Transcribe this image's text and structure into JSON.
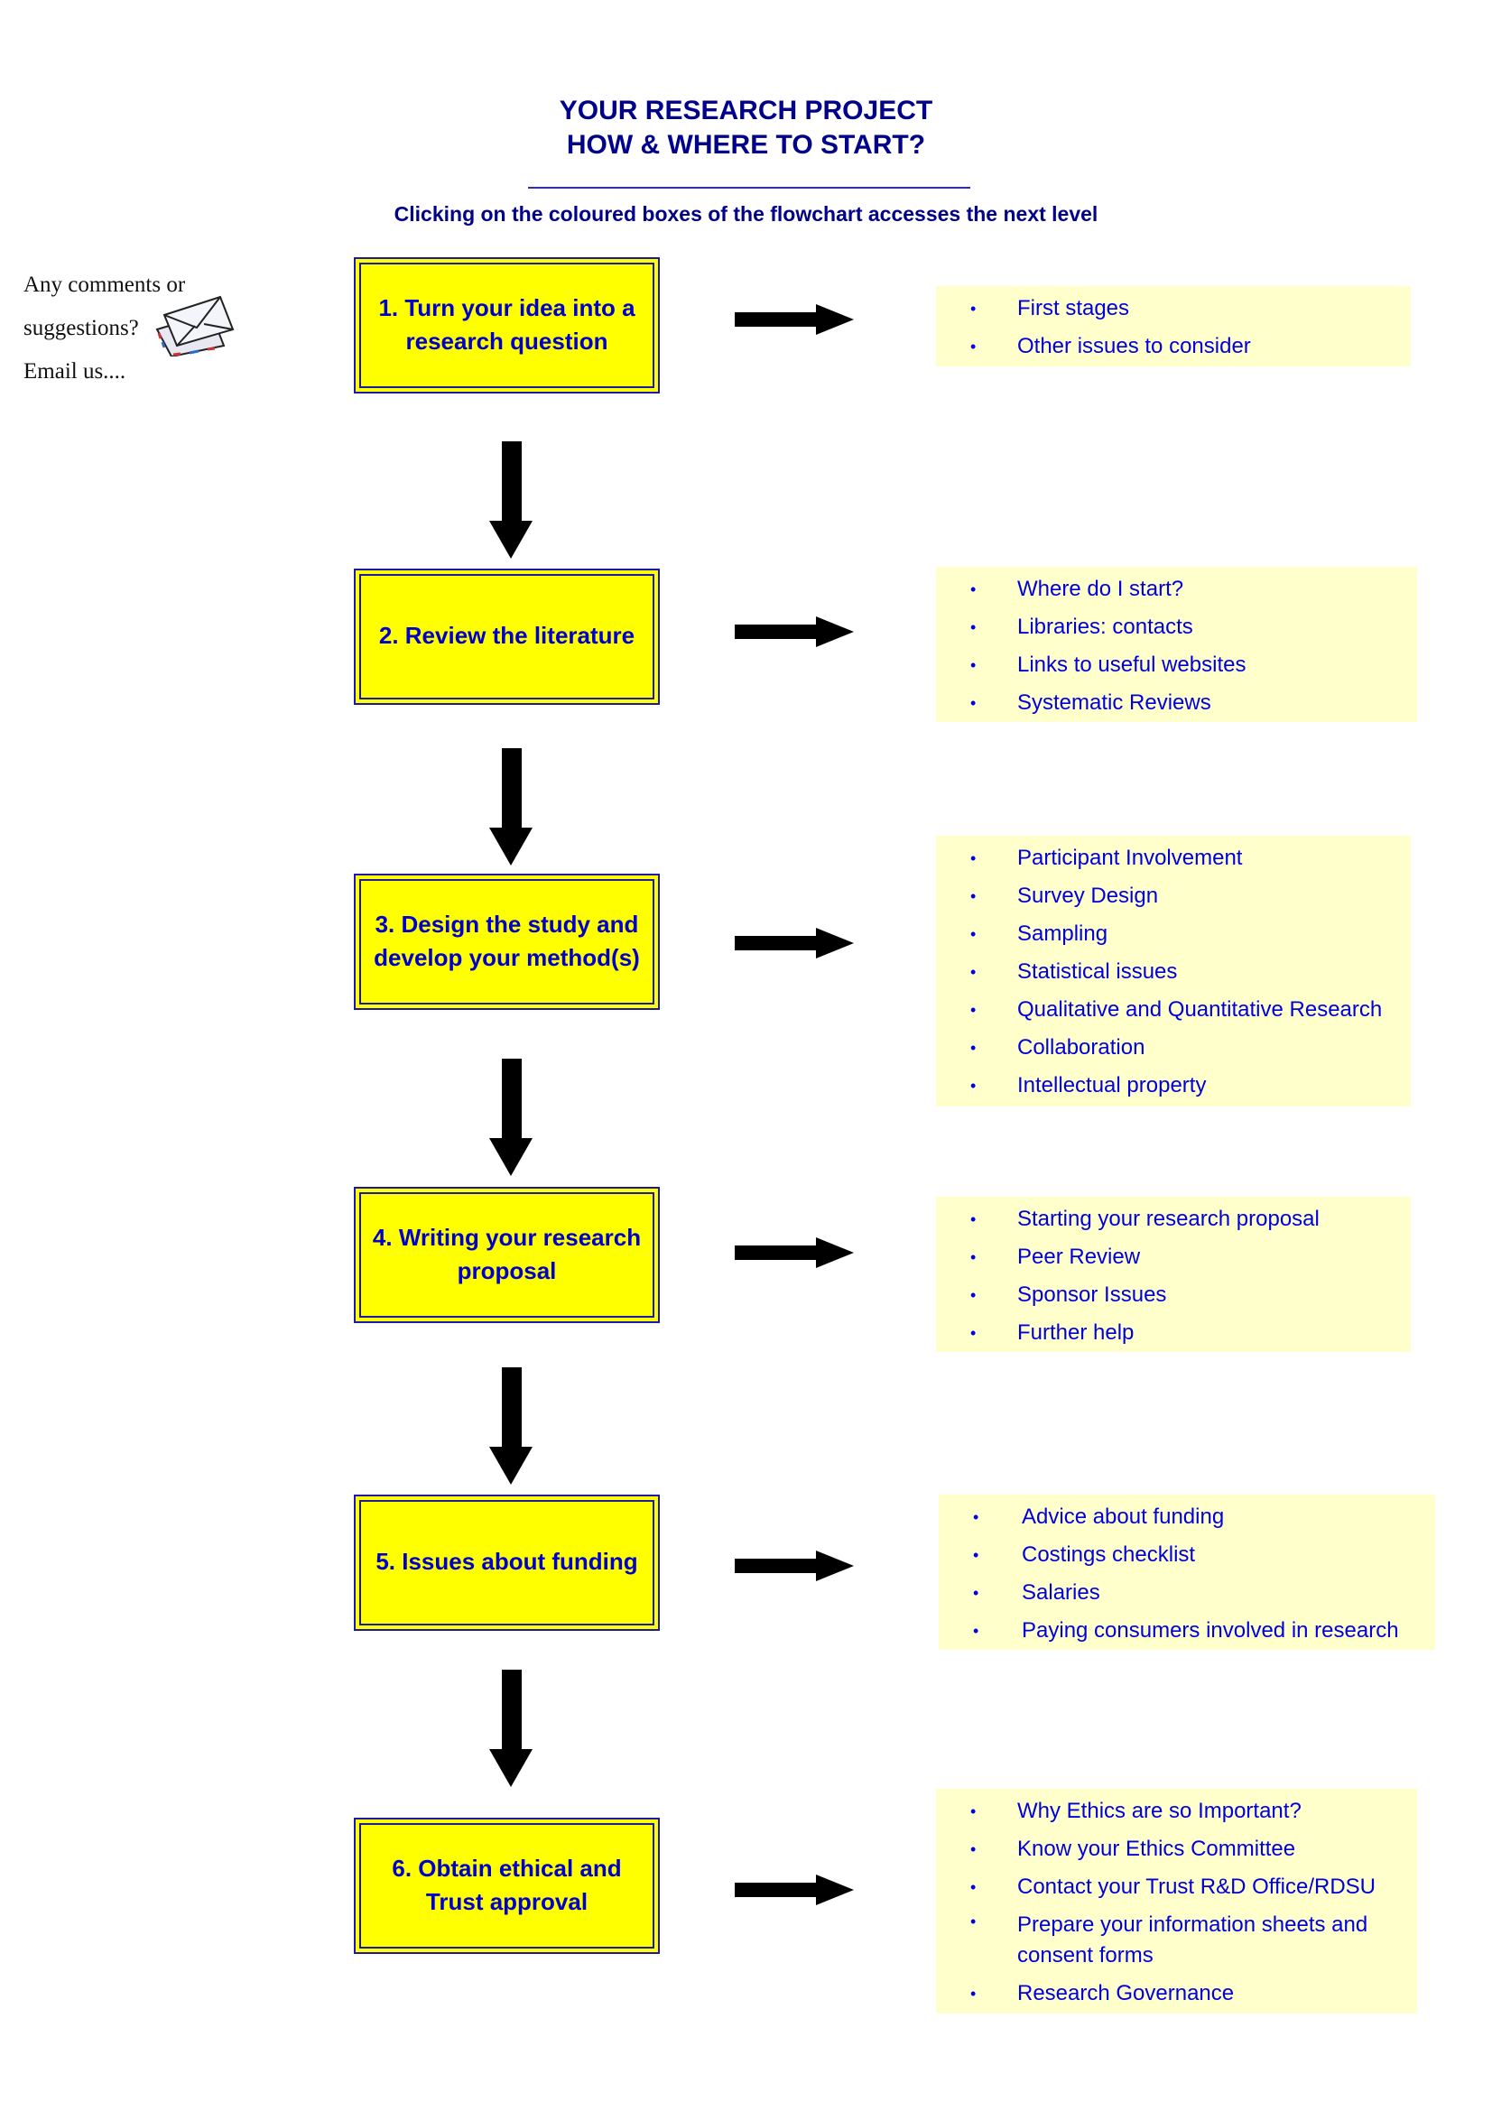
{
  "header": {
    "title_line1": "YOUR RESEARCH PROJECT",
    "title_line2": "HOW & WHERE TO START?",
    "subtitle": "Clicking on the coloured boxes of the flowchart accesses the next level"
  },
  "contact": {
    "line1": "Any comments or",
    "line2": "suggestions?",
    "line3": "Email us....",
    "icon": "envelope-icon"
  },
  "colors": {
    "title_text": "#00008b",
    "box_fill": "#ffff00",
    "box_border": "#1a1aa6",
    "box_text": "#0000cc",
    "panel_fill": "#ffffcc",
    "link_text": "#0000dd",
    "arrow": "#000000"
  },
  "steps": [
    {
      "label": "1. Turn your idea into a research question",
      "links": [
        "First stages",
        "Other issues to consider"
      ]
    },
    {
      "label": "2. Review the literature",
      "links": [
        "Where do I start?",
        "Libraries: contacts",
        "Links to useful websites",
        "Systematic Reviews"
      ]
    },
    {
      "label": "3. Design the study and develop your method(s)",
      "links": [
        "Participant Involvement",
        "Survey Design",
        "Sampling",
        "Statistical issues",
        "Qualitative and Quantitative Research",
        "Collaboration",
        "Intellectual property"
      ]
    },
    {
      "label": "4. Writing your research proposal",
      "links": [
        "Starting your research proposal",
        "Peer Review",
        "Sponsor Issues",
        "Further help"
      ]
    },
    {
      "label": "5. Issues about funding",
      "links": [
        "Advice about funding",
        "Costings checklist",
        "Salaries",
        "Paying consumers involved in research"
      ]
    },
    {
      "label": "6. Obtain ethical and Trust approval",
      "links": [
        "Why Ethics are so Important?",
        "Know your Ethics Committee",
        "Contact your Trust R&D Office/RDSU",
        "Prepare your information sheets and consent forms",
        "Research Governance"
      ]
    }
  ],
  "bullet_glyph": "•"
}
